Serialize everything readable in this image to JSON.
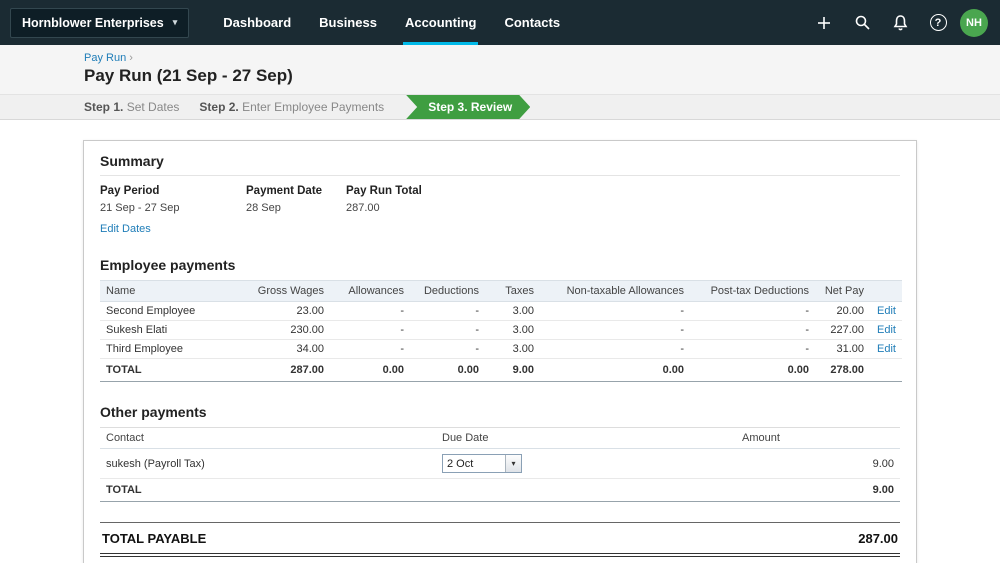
{
  "colors": {
    "navbar_bg": "#1b2b33",
    "accent_teal": "#00b9e8",
    "link_blue": "#1f7db8",
    "step_green": "#3f9e41",
    "avatar_green": "#4aa64f"
  },
  "icons": {
    "org_caret": "▾",
    "breadcrumb_chevron": "›",
    "select_caret": "▾",
    "help_glyph": "?"
  },
  "navbar": {
    "org_name": "Hornblower Enterprises",
    "items": [
      {
        "label": "Dashboard"
      },
      {
        "label": "Business"
      },
      {
        "label": "Accounting"
      },
      {
        "label": "Contacts"
      }
    ],
    "avatar_initials": "NH"
  },
  "header": {
    "breadcrumb": "Pay Run",
    "title": "Pay Run (21 Sep - 27 Sep)"
  },
  "steps": [
    {
      "prefix": "Step 1.",
      "label": "Set Dates"
    },
    {
      "prefix": "Step 2.",
      "label": "Enter Employee Payments"
    },
    {
      "prefix": "Step 3.",
      "label": "Review"
    }
  ],
  "summary": {
    "heading": "Summary",
    "pay_period_label": "Pay Period",
    "pay_period_value": "21 Sep - 27 Sep",
    "edit_dates_link": "Edit Dates",
    "payment_date_label": "Payment Date",
    "payment_date_value": "28 Sep",
    "pay_run_total_label": "Pay Run Total",
    "pay_run_total_value": "287.00"
  },
  "employee_payments": {
    "heading": "Employee payments",
    "columns": [
      "Name",
      "Gross Wages",
      "Allowances",
      "Deductions",
      "Taxes",
      "Non-taxable Allowances",
      "Post-tax Deductions",
      "Net Pay"
    ],
    "rows": [
      {
        "name": "Second Employee",
        "gross": "23.00",
        "allowances": "-",
        "deductions": "-",
        "taxes": "3.00",
        "nontax": "-",
        "posttax": "-",
        "net": "20.00",
        "edit": "Edit"
      },
      {
        "name": "Sukesh Elati",
        "gross": "230.00",
        "allowances": "-",
        "deductions": "-",
        "taxes": "3.00",
        "nontax": "-",
        "posttax": "-",
        "net": "227.00",
        "edit": "Edit"
      },
      {
        "name": "Third Employee",
        "gross": "34.00",
        "allowances": "-",
        "deductions": "-",
        "taxes": "3.00",
        "nontax": "-",
        "posttax": "-",
        "net": "31.00",
        "edit": "Edit"
      }
    ],
    "total": {
      "label": "TOTAL",
      "gross": "287.00",
      "allowances": "0.00",
      "deductions": "0.00",
      "taxes": "9.00",
      "nontax": "0.00",
      "posttax": "0.00",
      "net": "278.00"
    }
  },
  "other_payments": {
    "heading": "Other payments",
    "columns": [
      "Contact",
      "Due Date",
      "Amount"
    ],
    "rows": [
      {
        "contact": "sukesh (Payroll Tax)",
        "due_date": "2 Oct",
        "amount": "9.00"
      }
    ],
    "total": {
      "label": "TOTAL",
      "amount": "9.00"
    }
  },
  "total_payable": {
    "label": "TOTAL PAYABLE",
    "value": "287.00"
  }
}
